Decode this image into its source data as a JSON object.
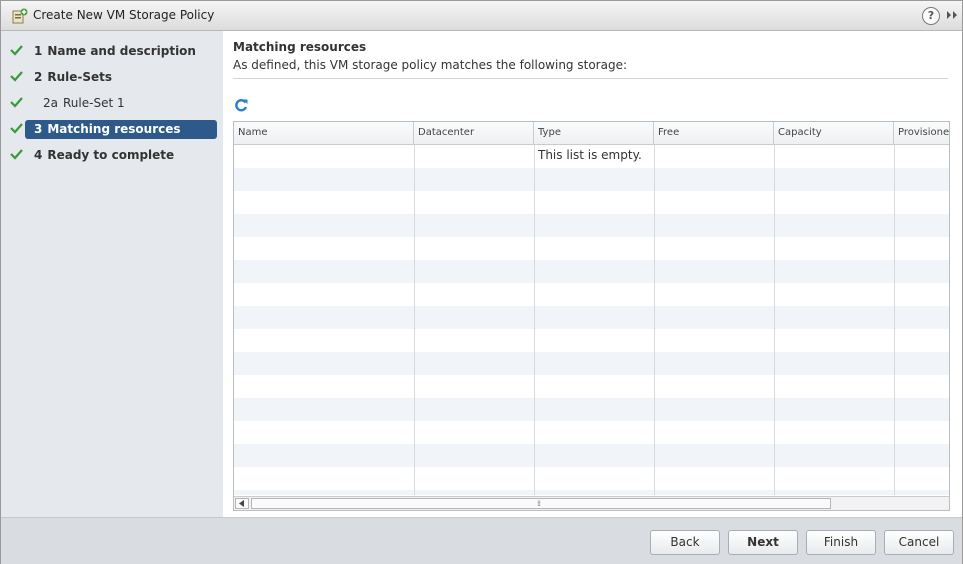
{
  "window": {
    "title": "Create New VM Storage Policy",
    "help_glyph": "?",
    "expand_icon": "double-chevron-right-icon"
  },
  "nav": {
    "items": [
      {
        "num": "1",
        "label": "Name and description",
        "state": "complete"
      },
      {
        "num": "2",
        "label": "Rule-Sets",
        "state": "complete"
      },
      {
        "num": "2a",
        "label": "Rule-Set 1",
        "state": "complete",
        "sub": true
      },
      {
        "num": "3",
        "label": "Matching resources",
        "state": "active"
      },
      {
        "num": "4",
        "label": "Ready to complete",
        "state": "complete"
      }
    ]
  },
  "main": {
    "title": "Matching resources",
    "description": "As defined, this VM storage policy matches the following storage:",
    "refresh_icon": "refresh-icon",
    "grid": {
      "columns": [
        "Name",
        "Datacenter",
        "Type",
        "Free",
        "Capacity",
        "Provisione"
      ],
      "empty_message": "This list is empty.",
      "rows": []
    }
  },
  "footer": {
    "back_label": "Back",
    "next_label": "Next",
    "finish_label": "Finish",
    "cancel_label": "Cancel"
  },
  "colors": {
    "active_nav_bg": "#2d5a8a",
    "check_green": "#3a9a3a",
    "refresh_blue": "#2a7fd4"
  }
}
